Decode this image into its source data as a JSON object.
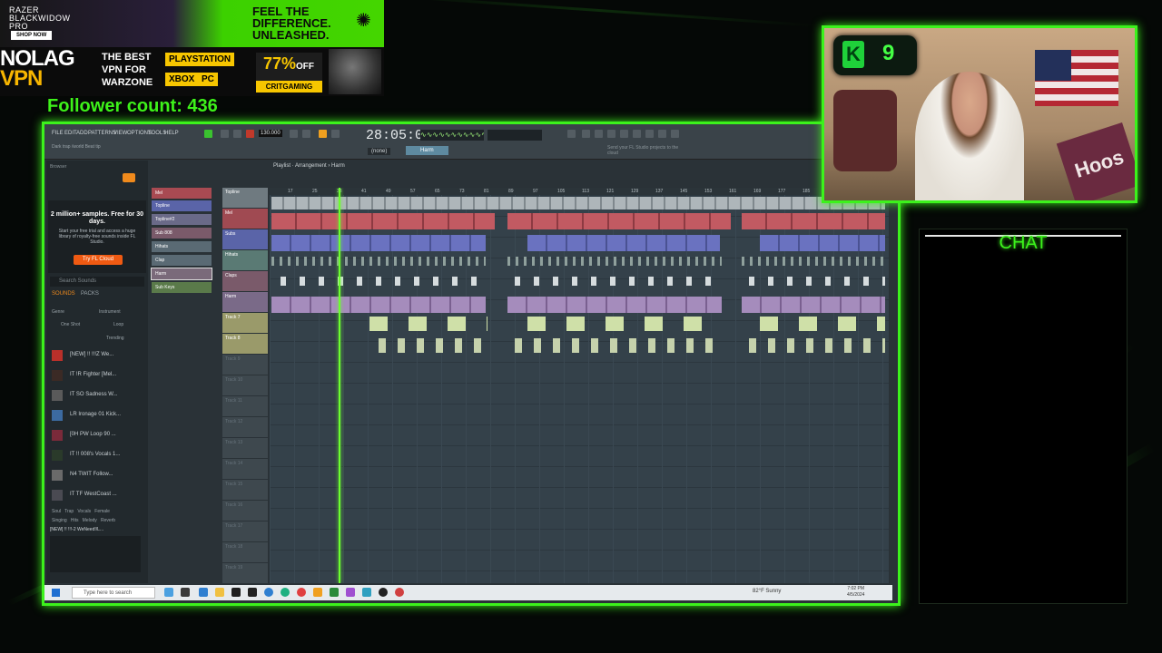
{
  "ads": {
    "razer": {
      "brand_line1": "RAZER",
      "brand_line2": "BLACKWIDOW",
      "brand_line3": "PRO",
      "shop": "SHOP NOW",
      "slogan1": "FEEL THE",
      "slogan2": "DIFFERENCE.",
      "slogan3": "UNLEASHED."
    },
    "vpn": {
      "logo1": "NOLAG",
      "logo2": "VPN",
      "tag1": "THE BEST",
      "tag2": "VPN FOR",
      "tag3": "WARZONE",
      "platform1": "PLAYSTATION",
      "platform2": "XBOX",
      "platform3": "PC",
      "discount": "77%",
      "off": "OFF",
      "code": "CRITGAMING"
    }
  },
  "follower": "Follower count: 436",
  "fl": {
    "menu": [
      "FILE",
      "EDIT",
      "ADD",
      "PATTERNS",
      "VIEW",
      "OPTIONS",
      "TOOLS",
      "HELP"
    ],
    "bpm": "130.000",
    "clock": "28:05:07",
    "pattern": "Harm",
    "mode": "(none)",
    "project": "Dark trap /world Beat tip",
    "hint": "Send your FL Studio projects to the cloud",
    "breadcrumb": "Playlist · Arrangement › Harm",
    "browser_title": "Browser",
    "promo": {
      "headline": "2 million+ samples. Free for 30 days.",
      "sub": "Start your free trial and access a huge library of royalty-free sounds inside FL Studio.",
      "button": "Try FL Cloud"
    },
    "search_placeholder": "Search Sounds",
    "tabs": [
      "SOUNDS",
      "PACKS"
    ],
    "filters": [
      "Genre",
      "Instrument",
      "One Shot",
      "Loop"
    ],
    "sort": "Trending",
    "samples": [
      {
        "label": "[NEW] !! !!!Z We..."
      },
      {
        "label": "IT !R Fighter [Mel..."
      },
      {
        "label": "IT SO Sadness W..."
      },
      {
        "label": "LR Ironage 01 Kick..."
      },
      {
        "label": "[0H PW Loop 90 ..."
      },
      {
        "label": "IT !! 008's Vocals 1..."
      },
      {
        "label": "N4 TWIT Follow..."
      },
      {
        "label": "IT TF WestCoast ..."
      }
    ],
    "tags": [
      "Soul",
      "Trap",
      "Vocals",
      "Female",
      "Singing",
      "Hits",
      "Melody",
      "Reverb"
    ],
    "preview_sample": "[NEW] !! !!!-2 WeNeed!/L...",
    "channels": [
      "Mel",
      "Topline",
      "Topline#2",
      "Sub 808",
      "Hihats",
      "Clap",
      "Harm",
      "Sub Keys"
    ],
    "tracks": [
      "Topline",
      "Mel",
      "Subs",
      "Hihats",
      "Claps",
      "Harm",
      "Track 7",
      "Track 8",
      "Track 9",
      "Track 10",
      "Track 11",
      "Track 12",
      "Track 13",
      "Track 14",
      "Track 15",
      "Track 16",
      "Track 17",
      "Track 18",
      "Track 19"
    ],
    "ruler": [
      "17",
      "25",
      "33",
      "41",
      "49",
      "57",
      "65",
      "73",
      "81",
      "89",
      "97",
      "105",
      "113",
      "121",
      "129",
      "137",
      "145",
      "153",
      "161",
      "169",
      "177",
      "185",
      "193",
      "201",
      "209"
    ],
    "taskbar": {
      "search": "Type here to search",
      "weather": "82°F Sunny",
      "time": "7:02 PM",
      "date": "4/5/2024"
    }
  },
  "webcam": {
    "badge_letter": "K",
    "badge_number": "9",
    "banner": "Hoos"
  },
  "chat": {
    "title": "CHAT"
  }
}
